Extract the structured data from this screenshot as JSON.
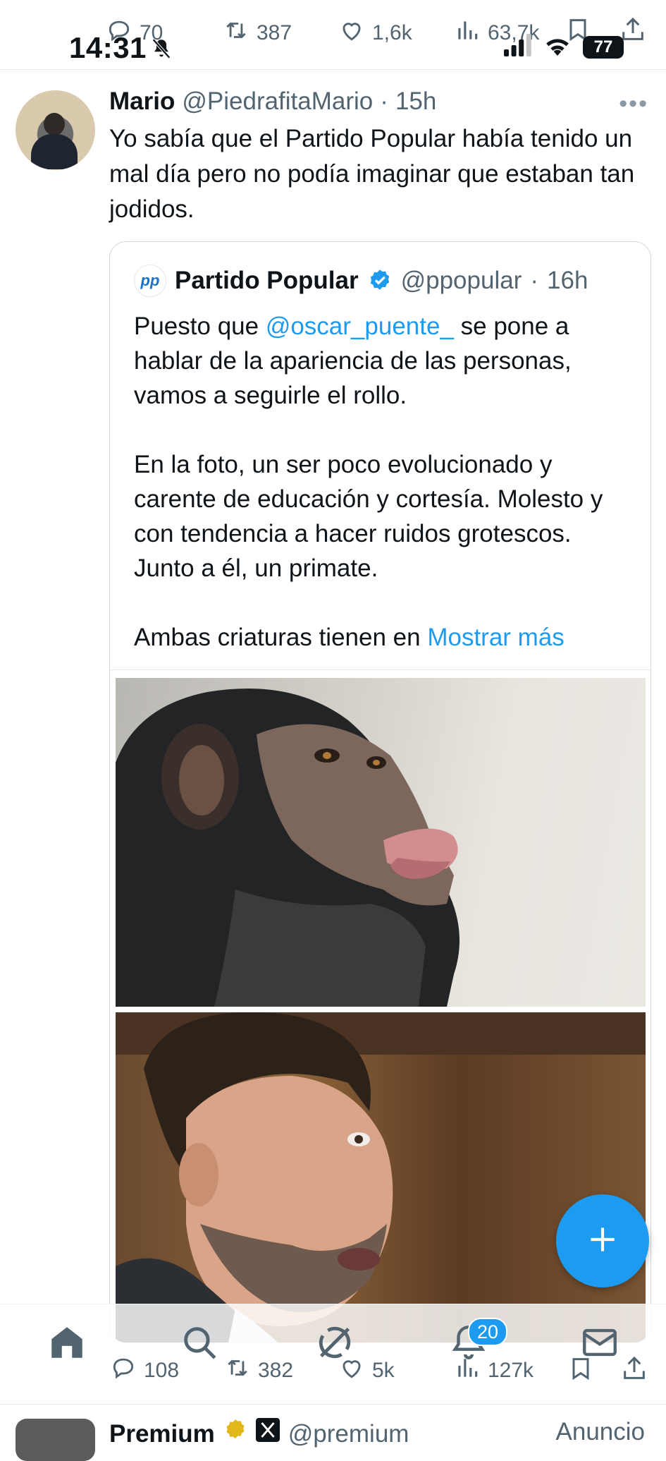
{
  "status_bar": {
    "time": "14:31",
    "battery": "77"
  },
  "top_actions": {
    "replies": "70",
    "retweets": "387",
    "likes": "1,6k",
    "views": "63,7k"
  },
  "tweet": {
    "name": "Mario",
    "handle": "@PiedrafitaMario",
    "dot": "·",
    "time": "15h",
    "text": "Yo sabía que el Partido Popular había tenido un mal día pero no podía imaginar que estaban tan jodidos."
  },
  "quoted": {
    "logo": "pp",
    "name": "Partido Popular",
    "handle": "@ppopular",
    "dot": "·",
    "time": "16h",
    "p1_before": "Puesto que ",
    "p1_mention": "@oscar_puente_",
    "p1_after": " se pone a hablar de la apariencia de las personas, vamos a seguirle el rollo.",
    "p2": "En la foto, un ser poco evolucionado y carente de educación y cortesía. Molesto y con tendencia a hacer ruidos grotescos. Junto a él, un primate.",
    "p3_before": "Ambas criaturas tienen en ",
    "show_more": "Mostrar más"
  },
  "bottom_actions": {
    "replies": "108",
    "retweets": "382",
    "likes": "5k",
    "views": "127k"
  },
  "notifications_badge": "20",
  "next_tweet": {
    "name": "Premium",
    "handle": "@premium",
    "ad_label": "Anuncio"
  },
  "colors": {
    "accent": "#1d9bf0",
    "text": "#0f1419",
    "muted": "#536471"
  }
}
